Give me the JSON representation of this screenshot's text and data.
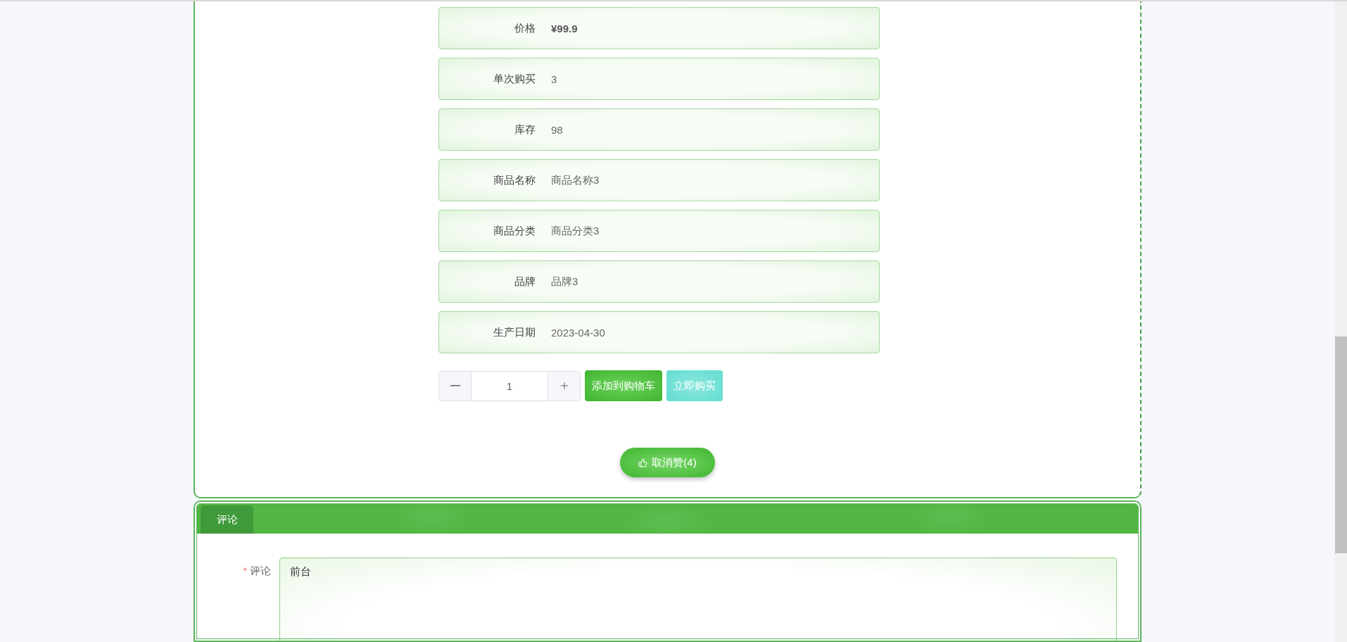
{
  "product_fields": [
    {
      "label": "价格",
      "value": "¥99.9",
      "kind": "price"
    },
    {
      "label": "单次购买",
      "value": "3",
      "kind": "text"
    },
    {
      "label": "库存",
      "value": "98",
      "kind": "text"
    },
    {
      "label": "商品名称",
      "value": "商品名称3",
      "kind": "text"
    },
    {
      "label": "商品分类",
      "value": "商品分类3",
      "kind": "text"
    },
    {
      "label": "品牌",
      "value": "品牌3",
      "kind": "text"
    },
    {
      "label": "生产日期",
      "value": "2023-04-30",
      "kind": "text"
    }
  ],
  "quantity": {
    "value": "1"
  },
  "buttons": [
    {
      "label": "添加到购物车",
      "kind": "cart"
    },
    {
      "label": "立即购买",
      "kind": "buy"
    }
  ],
  "like_button": {
    "label": "取消赞(4)"
  },
  "comment_section": {
    "tab": "评论",
    "field_label": "评论",
    "required": true,
    "required_mark": "*",
    "value": "前台"
  }
}
